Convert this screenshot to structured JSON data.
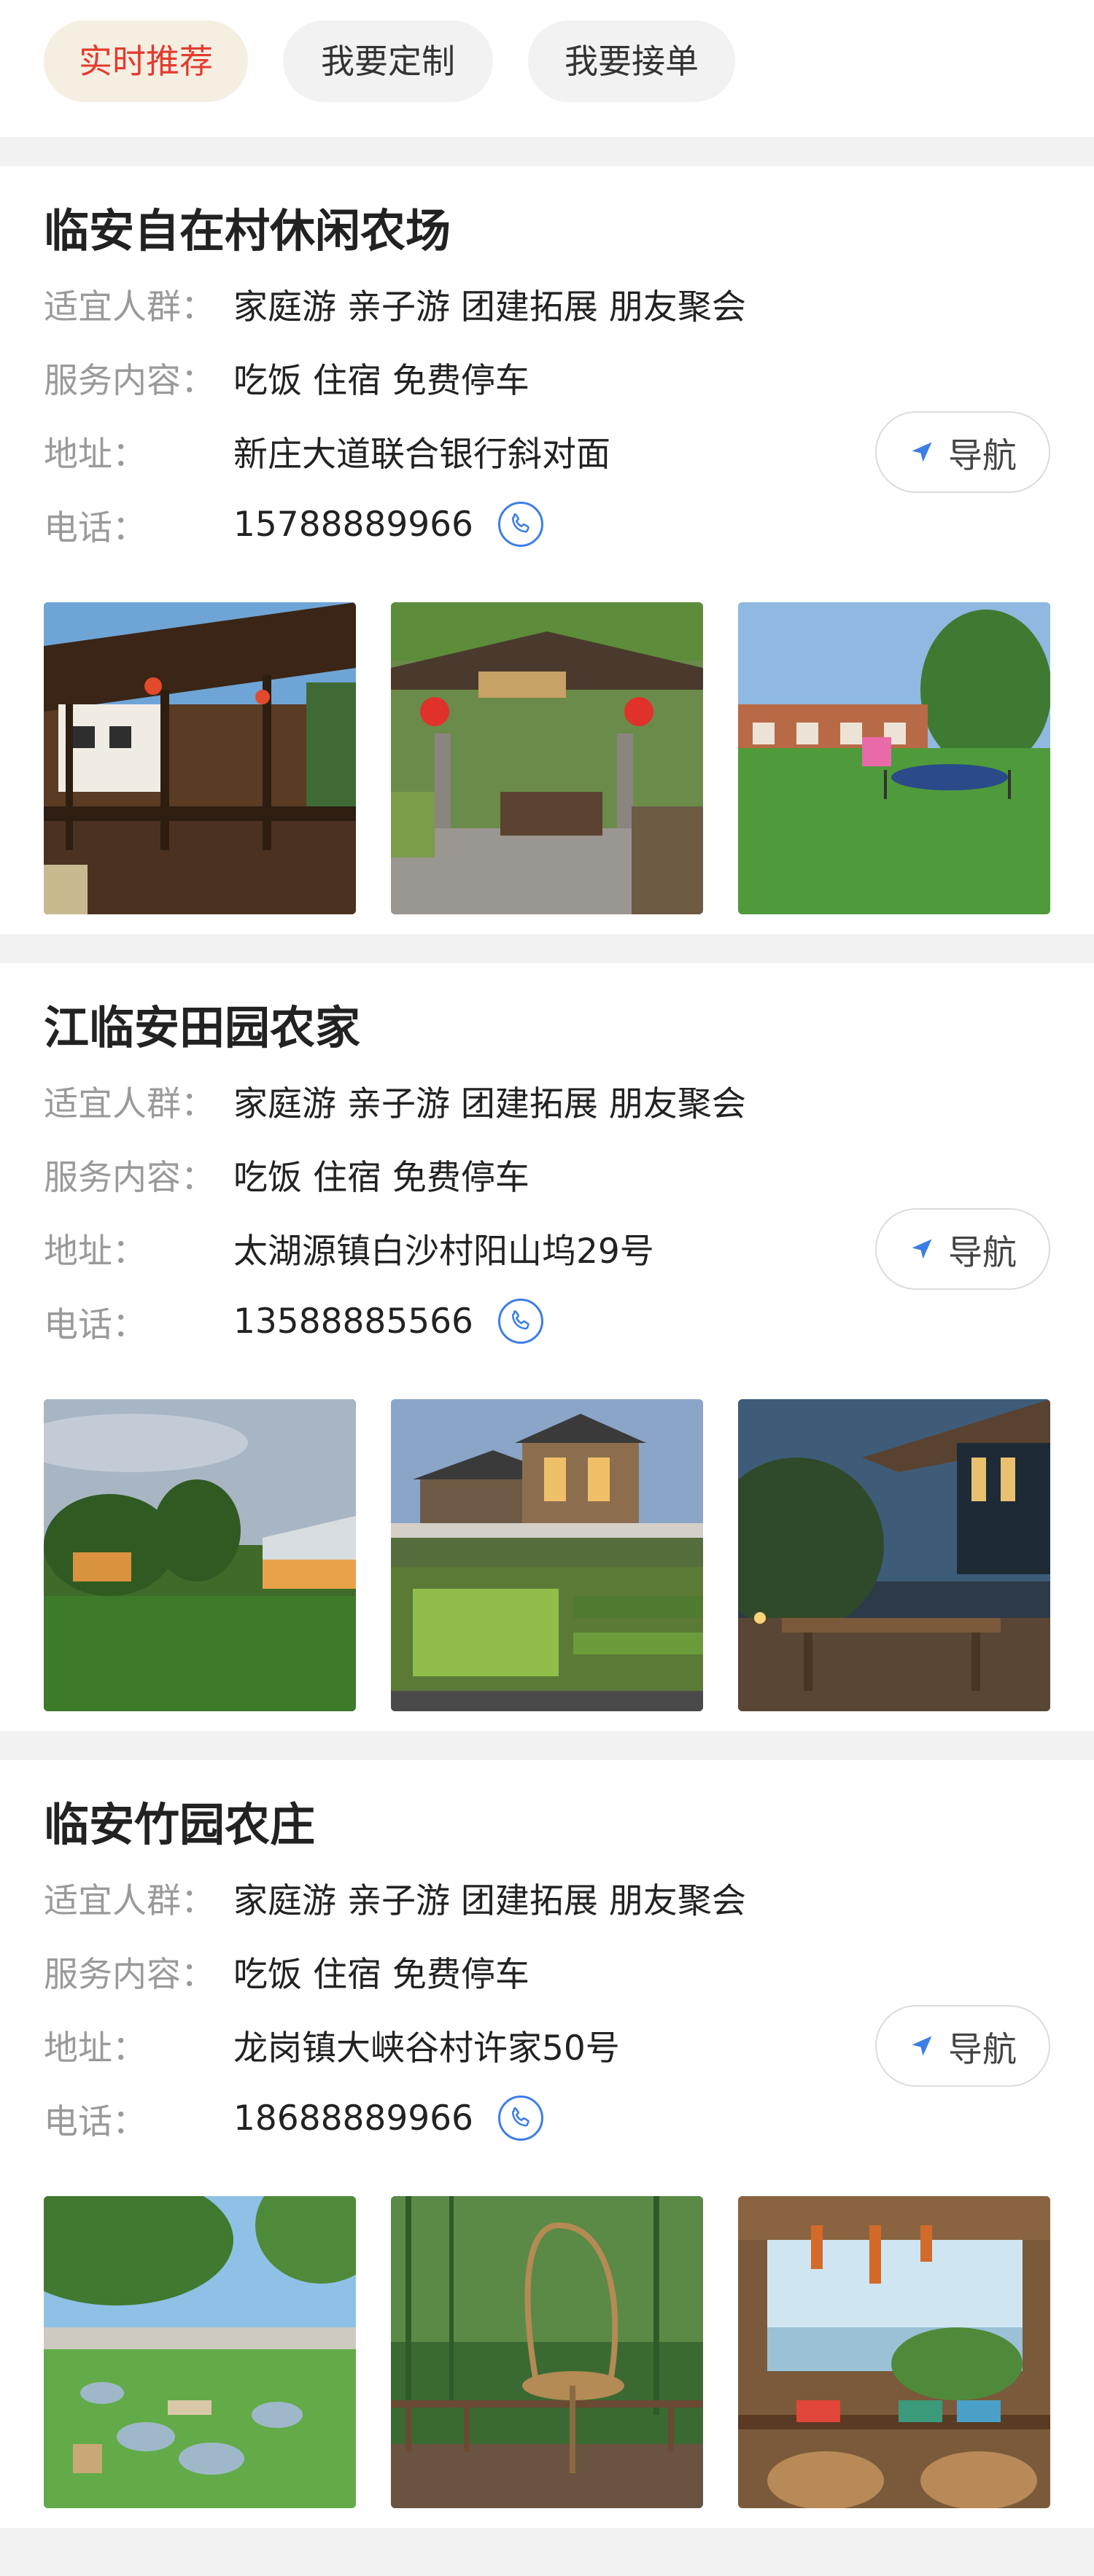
{
  "tabs": [
    {
      "label": "实时推荐",
      "active": true
    },
    {
      "label": "我要定制",
      "active": false
    },
    {
      "label": "我要接单",
      "active": false
    }
  ],
  "labels": {
    "audience": "适宜人群：",
    "services": "服务内容：",
    "address": "地址：",
    "phone": "电话："
  },
  "nav_button_label": "导航",
  "accent_color": "#e33b2f",
  "link_color": "#3d7ee6",
  "farms": [
    {
      "name": "临安自在村休闲农场",
      "audience": "家庭游 亲子游 团建拓展 朋友聚会",
      "services": "吃饭 住宿 免费停车",
      "address": "新庄大道联合银行斜对面",
      "phone": "15788889966",
      "photos": [
        "pavilion-corridor-photo",
        "courtyard-lanterns-photo",
        "lawn-trampoline-photo"
      ]
    },
    {
      "name": "江临安田园农家",
      "audience": "家庭游 亲子游 团建拓展 朋友聚会",
      "services": "吃饭 住宿 免费停车",
      "address": "太湖源镇白沙村阳山坞29号",
      "phone": "13588885566",
      "photos": [
        "dusk-lawn-house-photo",
        "garden-villa-photo",
        "terrace-dining-photo"
      ]
    },
    {
      "name": "临安竹园农庄",
      "audience": "家庭游 亲子游 团建拓展 朋友聚会",
      "services": "吃饭 住宿 免费停车",
      "address": "龙岗镇大峡谷村许家50号",
      "phone": "18688889966",
      "photos": [
        "lawn-beanbags-photo",
        "rattan-swing-chair-photo",
        "seaside-cafe-photo"
      ]
    }
  ]
}
